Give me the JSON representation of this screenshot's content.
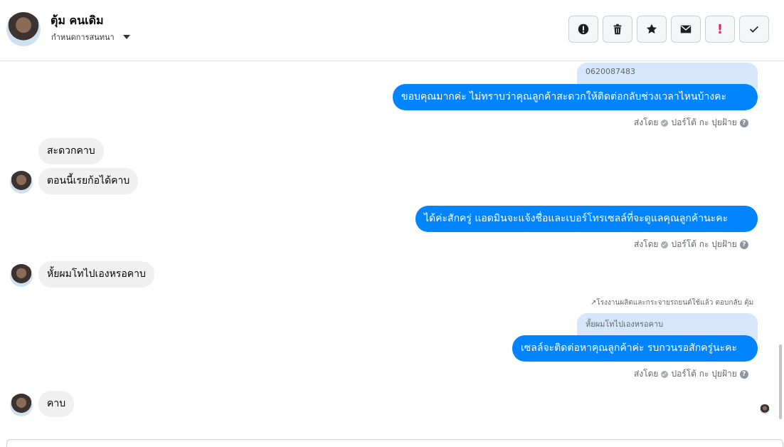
{
  "header": {
    "contact_name": "ตุ้ม คนเดิม",
    "assign_label": "กำหนดการสนทนา"
  },
  "actions": [
    {
      "icon": "alert-circle-icon",
      "label": ""
    },
    {
      "icon": "trash-icon",
      "label": ""
    },
    {
      "icon": "star-icon",
      "label": ""
    },
    {
      "icon": "mail-icon",
      "label": ""
    },
    {
      "icon": "exclamation-icon",
      "label": "!"
    },
    {
      "icon": "check-icon",
      "label": ""
    }
  ],
  "messages": {
    "q1": "0620087483",
    "m1": "ขอบคุณมากค่ะ ไม่ทราบว่าคุณลูกค้าสะดวกให้ติดต่อกลับช่วงเวลาไหนบ้างคะ",
    "in1": "สะดวกคาบ",
    "in2": "ตอนนี้เรยก้อได้คาบ",
    "m2": "ได้ค่ะสักครู่ แอดมินจะแจ้งชื่อและเบอร์โทรเซลล์ที่จะดูแลคุณลูกค้านะคะ",
    "in3": "หั้ยผมโทไปเองหรอคาบ",
    "reply_note": "โรงงานผลิตและกระจายรถยนต์ใช้แล้ว ตอบกลับ ตุ้ม",
    "q3": "หั้ยผมโทไปเองหรอคาบ",
    "m3": "เซลล์จะติดต่อหาคุณลูกค้าค่ะ รบกวนรอสักครู่นะคะ",
    "in4": "คาบ"
  },
  "sent_by": {
    "prefix": "ส่งโดย",
    "agent": "ปอร์โต้ กะ ปุยฝ้าย",
    "help": "?"
  }
}
